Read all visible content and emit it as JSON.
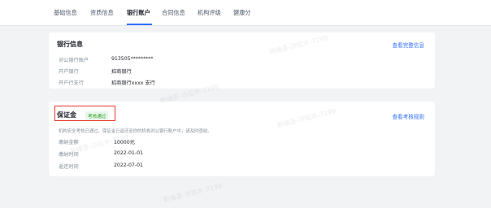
{
  "tabs": [
    {
      "label": "基础信息"
    },
    {
      "label": "资质信息"
    },
    {
      "label": "银行账户"
    },
    {
      "label": "合同信息"
    },
    {
      "label": "机构评级"
    },
    {
      "label": "健康分"
    }
  ],
  "active_tab": "银行账户",
  "bank_card": {
    "title": "银行信息",
    "link": "查看完整信息",
    "rows": [
      {
        "key": "对公银行账户",
        "value": "913505*********"
      },
      {
        "key": "开户银行",
        "value": "招商银行"
      },
      {
        "key": "开户行支行",
        "value": "招商银行xxxx 支行"
      }
    ]
  },
  "deposit_card": {
    "title": "保证金",
    "badge": "考核通过",
    "link": "查看考核规则",
    "notice": "机构安全考核已通过，保证金已返还至你的机构对公银行账户中，请及时查收。",
    "rows": [
      {
        "key": "缴纳金额",
        "value": "10000元"
      },
      {
        "key": "缴纳时间",
        "value": "2022-01-01"
      },
      {
        "key": "返还时间",
        "value": "2022-07-01"
      }
    ]
  },
  "colors": {
    "accent": "#3370ff",
    "success_badge_bg": "#e8f7ea",
    "success_badge_text": "#2ea121",
    "highlight": "#e5372b"
  },
  "watermark": "新维圣-沙拉木-7199"
}
